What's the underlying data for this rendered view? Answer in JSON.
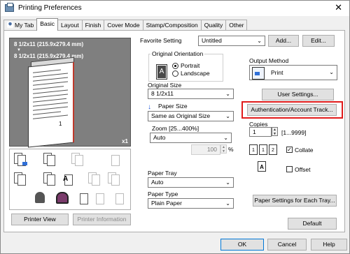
{
  "window": {
    "title": "Printing Preferences",
    "close_glyph": "✕"
  },
  "tabs": [
    "My Tab",
    "Basic",
    "Layout",
    "Finish",
    "Cover Mode",
    "Stamp/Composition",
    "Quality",
    "Other"
  ],
  "active_tab": "Basic",
  "preview": {
    "line1": "8 1/2x11 (215.9x279.4 mm)",
    "arrow": "▼",
    "line2": "8 1/2x11 (215.9x279.4 mm)",
    "page_number": "1",
    "zoom": "x1"
  },
  "icon_grid_items": [
    "document-icon",
    "document-icon",
    "document-icon",
    "stamp-icon",
    "document-icon",
    "document-icon",
    "text-icon",
    "booklet-icon",
    "document-icon",
    "person-icon",
    "person-icon",
    "page-icon",
    "page-icon",
    "page-icon"
  ],
  "buttons": {
    "printer_view": "Printer View",
    "printer_information": "Printer Information",
    "add": "Add...",
    "edit": "Edit...",
    "user_settings": "User Settings...",
    "authentication": "Authentication/Account Track...",
    "paper_settings": "Paper Settings for Each Tray...",
    "default": "Default",
    "ok": "OK",
    "cancel": "Cancel",
    "help": "Help"
  },
  "favorite_setting": {
    "label": "Favorite Setting",
    "value": "Untitled"
  },
  "original_orientation": {
    "label": "Original Orientation",
    "portrait": "Portrait",
    "landscape": "Landscape",
    "selected": "Portrait"
  },
  "original_size": {
    "label": "Original Size",
    "value": "8 1/2x11"
  },
  "paper_size": {
    "label": "Paper Size",
    "value": "Same as Original Size"
  },
  "zoom": {
    "label": "Zoom [25...400%]",
    "value": "Auto",
    "percent_value": "100",
    "percent_unit": "%"
  },
  "paper_tray": {
    "label": "Paper Tray",
    "value": "Auto"
  },
  "paper_type": {
    "label": "Paper Type",
    "value": "Plain Paper"
  },
  "output_method": {
    "label": "Output Method",
    "value": "Print"
  },
  "copies": {
    "label": "Copies",
    "value": "1",
    "range": "[1...9999]"
  },
  "collate": {
    "label": "Collate",
    "checked": true,
    "check_glyph": "✓"
  },
  "offset": {
    "label": "Offset",
    "checked": false
  },
  "colors": {
    "highlight": "#e01b1b",
    "accent_blue": "#2f6fd8"
  }
}
